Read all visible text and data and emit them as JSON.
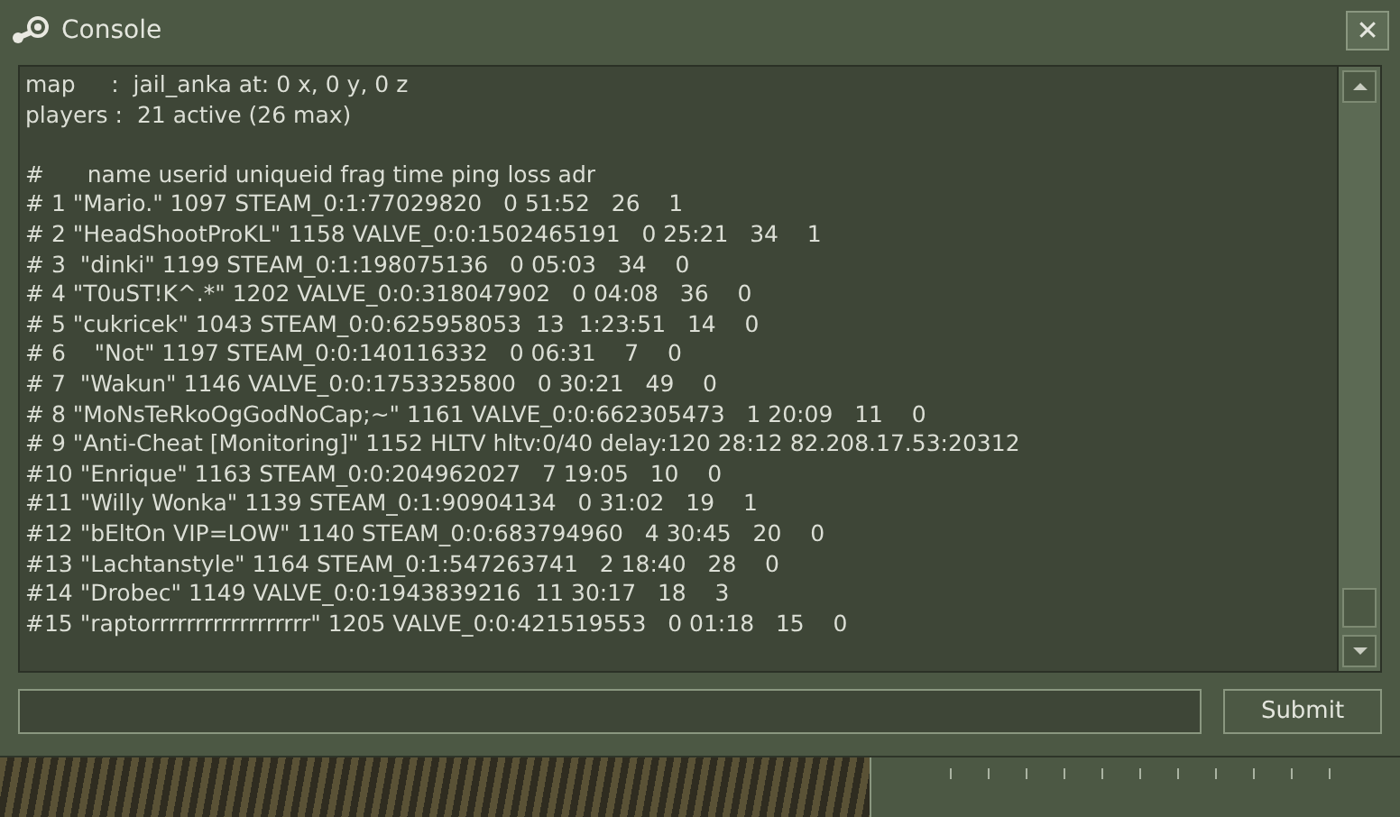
{
  "window": {
    "title": "Console",
    "close": "✕"
  },
  "console": {
    "info_lines": [
      "map     :  jail_anka at: 0 x, 0 y, 0 z",
      "players :  21 active (26 max)"
    ],
    "table_lines": [
      "#      name userid uniqueid frag time ping loss adr",
      "# 1 \"Mario.\" 1097 STEAM_0:1:77029820   0 51:52   26    1",
      "# 2 \"HeadShootProKL\" 1158 VALVE_0:0:1502465191   0 25:21   34    1",
      "# 3  \"dinki\" 1199 STEAM_0:1:198075136   0 05:03   34    0",
      "# 4 \"T0uST!K^.*\" 1202 VALVE_0:0:318047902   0 04:08   36    0",
      "# 5 \"cukricek\" 1043 STEAM_0:0:625958053  13  1:23:51   14    0",
      "# 6    \"Not\" 1197 STEAM_0:0:140116332   0 06:31    7    0",
      "# 7  \"Wakun\" 1146 VALVE_0:0:1753325800   0 30:21   49    0",
      "# 8 \"MoNsTeRkoOgGodNoCap;~\" 1161 VALVE_0:0:662305473   1 20:09   11    0",
      "# 9 \"Anti-Cheat [Monitoring]\" 1152 HLTV hltv:0/40 delay:120 28:12 82.208.17.53:20312",
      "#10 \"Enrique\" 1163 STEAM_0:0:204962027   7 19:05   10    0",
      "#11 \"Willy Wonka\" 1139 STEAM_0:1:90904134   0 31:02   19    1",
      "#12 \"bEltOn VIP=LOW\" 1140 STEAM_0:0:683794960   4 30:45   20    0",
      "#13 \"Lachtanstyle\" 1164 STEAM_0:1:547263741   2 18:40   28    0",
      "#14 \"Drobec\" 1149 VALVE_0:0:1943839216  11 30:17   18    3",
      "#15 \"raptorrrrrrrrrrrrrrrrrr\" 1205 VALVE_0:0:421519553   0 01:18   15    0"
    ]
  },
  "command": {
    "submit": "Submit"
  }
}
